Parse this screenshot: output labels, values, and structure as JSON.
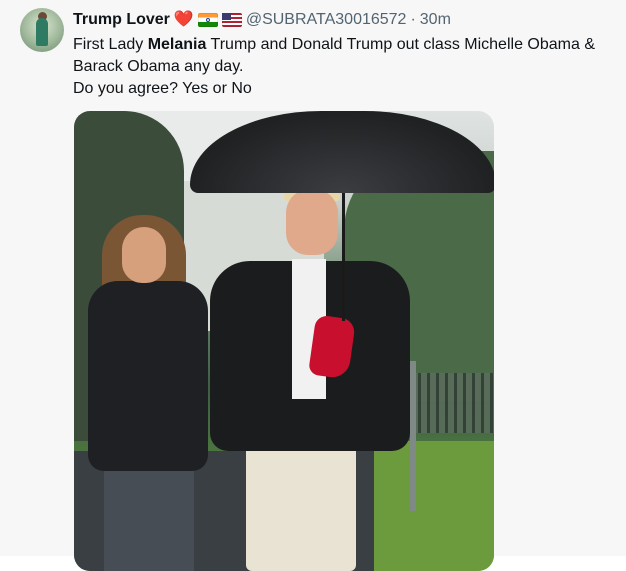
{
  "post": {
    "author_name": "Trump Lover",
    "heart_emoji": "❤️",
    "handle": "@SUBRATA30016572",
    "separator": "·",
    "time": "30m",
    "text": {
      "line1_before": "First Lady ",
      "line1_bold": "Melania",
      "line1_after": " Trump and Donald Trump out class Michelle Obama &",
      "line2": "Barack Obama any day.",
      "line3": "Do you agree? Yes or No"
    },
    "media": {
      "icon": "photo-image"
    }
  },
  "colors": {
    "text": "#0f1419",
    "secondary": "#536471",
    "heart": "#e0245e",
    "background": "#f7f7f7"
  },
  "icons": {
    "avatar": "profile-avatar",
    "flag_1": "india-flag-icon",
    "flag_2": "us-flag-icon"
  }
}
